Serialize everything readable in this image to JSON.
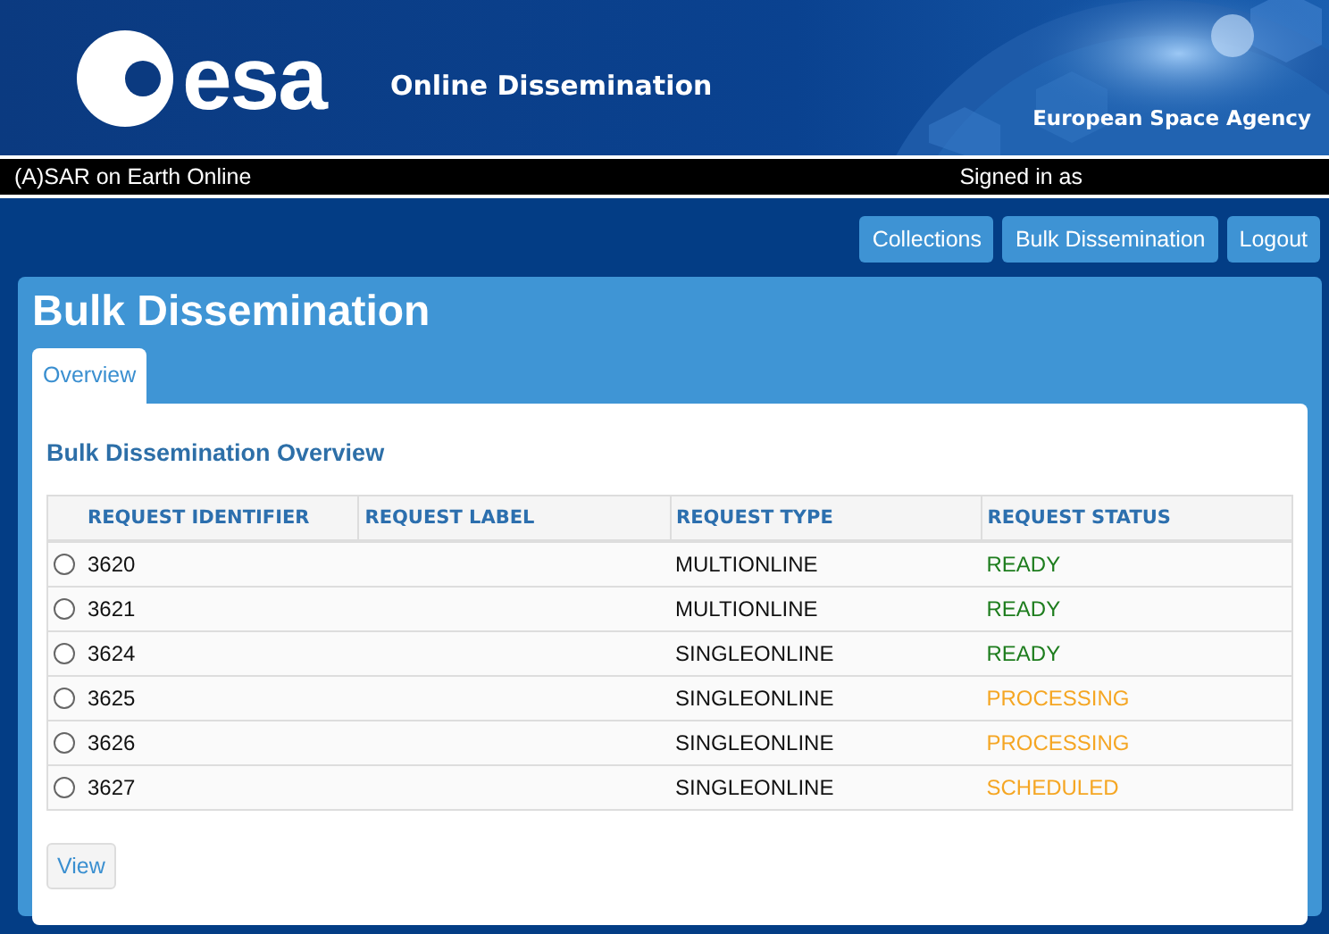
{
  "header": {
    "logo_text": "esa",
    "title": "Online Dissemination",
    "agency": "European Space Agency"
  },
  "topbar": {
    "site": "(A)SAR on Earth Online",
    "signed_in": "Signed in as"
  },
  "nav": [
    "Collections",
    "Bulk Dissemination",
    "Logout"
  ],
  "page_title": "Bulk Dissemination",
  "tabs": [
    {
      "label": "Overview",
      "selected": true
    }
  ],
  "section_title": "Bulk Dissemination Overview",
  "table": {
    "columns": [
      "REQUEST IDENTIFIER",
      "REQUEST LABEL",
      "REQUEST TYPE",
      "REQUEST STATUS"
    ],
    "rows": [
      {
        "selected": false,
        "id": "3620",
        "type": "MULTIONLINE",
        "status": "READY",
        "color": "#1e7d1e"
      },
      {
        "selected": false,
        "id": "3621",
        "type": "MULTIONLINE",
        "status": "READY",
        "color": "#1e7d1e"
      },
      {
        "selected": false,
        "id": "3624",
        "type": "SINGLEONLINE",
        "status": "READY",
        "color": "#1e7d1e"
      },
      {
        "selected": false,
        "id": "3625",
        "type": "SINGLEONLINE",
        "status": "PROCESSING",
        "color": "#f5a623"
      },
      {
        "selected": false,
        "id": "3626",
        "type": "SINGLEONLINE",
        "status": "PROCESSING",
        "color": "#f5a623"
      },
      {
        "selected": false,
        "id": "3627",
        "type": "SINGLEONLINE",
        "status": "SCHEDULED",
        "color": "#f5a623"
      }
    ]
  },
  "view_button": "View"
}
